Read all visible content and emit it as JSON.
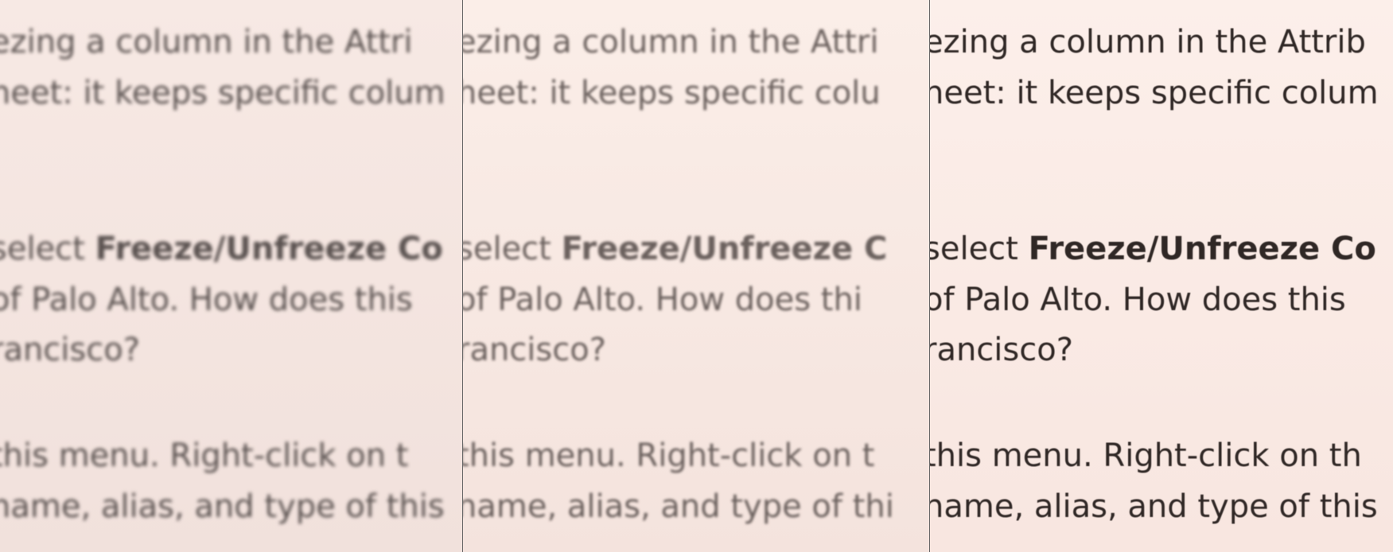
{
  "panels": [
    {
      "lines": [
        "ezing a column in the Attri",
        "heet: it keeps specific colum",
        "select ",
        "Freeze/Unfreeze Co",
        "of Palo Alto.  How does this",
        "rancisco?",
        "this menu.  Right-click on t",
        "name, alias, and type of this"
      ]
    },
    {
      "lines": [
        "ezing a column in the Attri",
        "heet: it keeps specific colu",
        "select ",
        "Freeze/Unfreeze C",
        "of Palo Alto.  How does thi",
        "rancisco?",
        "this menu.  Right-click on t",
        "name, alias, and type of thi"
      ]
    },
    {
      "lines": [
        "ezing a column in the Attrib",
        "heet: it keeps specific colum",
        "select ",
        "Freeze/Unfreeze Co",
        "of Palo Alto.  How does this",
        "rancisco?",
        "this menu.  Right-click on th",
        "name, alias, and type of this"
      ]
    }
  ]
}
